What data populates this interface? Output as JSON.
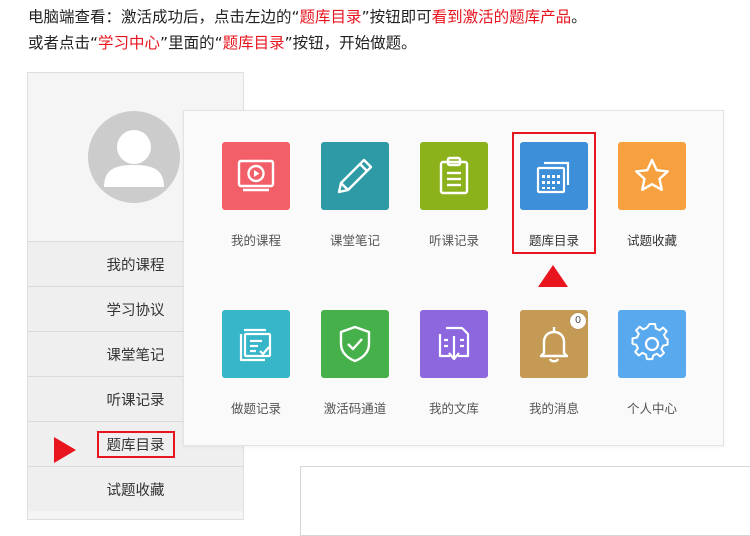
{
  "instructions": {
    "line1": {
      "part1": "电脑端查看：激活成功后，点击左边的“",
      "highlight1": "题库目录",
      "part2": "”按钮即可",
      "highlight2": "看到激活的题库产品",
      "part3": "。"
    },
    "line2": {
      "part1": "或者点击“",
      "highlight1": "学习中心",
      "part2": "”里面的“",
      "highlight2": "题库目录",
      "part3": "”按钮，开始做题。"
    }
  },
  "sidebar": {
    "items": [
      {
        "label": "我的课程"
      },
      {
        "label": "学习协议"
      },
      {
        "label": "课堂笔记"
      },
      {
        "label": "听课记录"
      },
      {
        "label": "题库目录"
      },
      {
        "label": "试题收藏"
      }
    ]
  },
  "popup": {
    "tiles": [
      {
        "label": "我的课程",
        "icon": "video-play-icon",
        "color": "#f25f69"
      },
      {
        "label": "课堂笔记",
        "icon": "pencil-icon",
        "color": "#2e9aa5"
      },
      {
        "label": "听课记录",
        "icon": "clipboard-icon",
        "color": "#8bb11b"
      },
      {
        "label": "题库目录",
        "icon": "question-bank-icon",
        "color": "#3d8fd9"
      },
      {
        "label": "试题收藏",
        "icon": "star-icon",
        "color": "#f7a03f"
      },
      {
        "label": "做题记录",
        "icon": "exercise-record-icon",
        "color": "#36b6c8"
      },
      {
        "label": "激活码通道",
        "icon": "shield-check-icon",
        "color": "#46b04a"
      },
      {
        "label": "我的文库",
        "icon": "document-download-icon",
        "color": "#8c67de"
      },
      {
        "label": "我的消息",
        "icon": "bell-icon",
        "color": "#c49a55",
        "badge": "0"
      },
      {
        "label": "个人中心",
        "icon": "gear-icon",
        "color": "#59a9ee"
      }
    ]
  },
  "colors": {
    "highlight": "#e8141e"
  }
}
